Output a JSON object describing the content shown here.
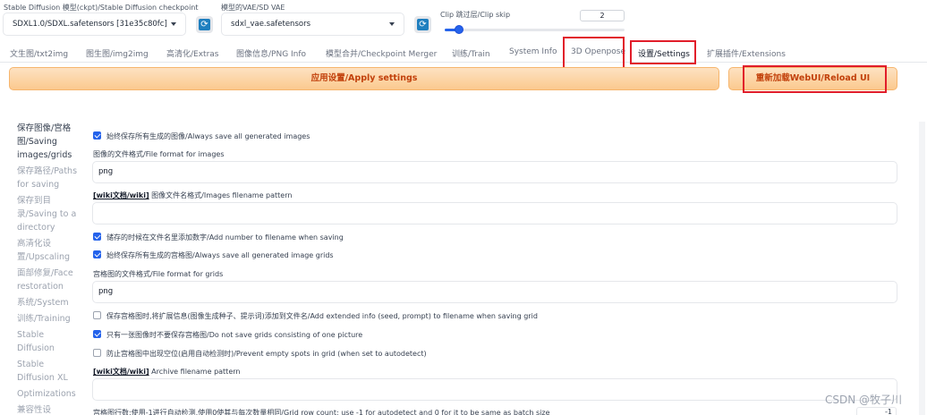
{
  "top": {
    "checkpoint_label": "Stable Diffusion 模型(ckpt)/Stable Diffusion checkpoint",
    "checkpoint_value": "SDXL1.0/SDXL.safetensors [31e35c80fc]",
    "vae_label": "模型的VAE/SD VAE",
    "vae_value": "sdxl_vae.safetensors",
    "clip_label": "Clip 跳过层/Clip skip",
    "clip_value": "2",
    "clip_fraction": 0.08,
    "refresh_glyph": "⟳"
  },
  "tabs": [
    {
      "label": "文生图/txt2img"
    },
    {
      "label": "图生图/img2img"
    },
    {
      "label": "高清化/Extras"
    },
    {
      "label": "图像信息/PNG Info"
    },
    {
      "label": "模型合并/Checkpoint Merger"
    },
    {
      "label": "训练/Train"
    },
    {
      "label": "System Info"
    },
    {
      "label": "3D Openpose"
    },
    {
      "label": "设置/Settings"
    },
    {
      "label": "扩展插件/Extensions"
    }
  ],
  "buttons": {
    "apply": "应用设置/Apply settings",
    "reload": "重新加载WebUI/Reload UI"
  },
  "nav": [
    "保存图像/宫格图/Saving images/grids",
    "保存路径/Paths for saving",
    "保存到目录/Saving to a directory",
    "高清化设置/Upscaling",
    "面部修复/Face restoration",
    "系统/System",
    "训练/Training",
    "Stable Diffusion",
    "Stable Diffusion XL",
    "Optimizations",
    "兼容性设"
  ],
  "settings": {
    "save_all": "始终保存所有生成的图像/Always save all generated images",
    "file_format_label": "图像的文件格式/File format for images",
    "file_format_value": "png",
    "wiki": "[wiki文档/wiki]",
    "filename_pattern_label": "图像文件名格式/Images filename pattern",
    "filename_pattern_value": "",
    "add_number": "储存的时候在文件名里添加数字/Add number to filename when saving",
    "save_grids": "始终保存所有生成的宫格图/Always save all generated image grids",
    "grid_format_label": "宫格图的文件格式/File format for grids",
    "grid_format_value": "png",
    "extended_info": "保存宫格图时,将扩展信息(图像生成种子、提示词)添加到文件名/Add extended info (seed, prompt) to filename when saving grid",
    "no_single_grid": "只有一张图像时不要保存宫格图/Do not save grids consisting of one picture",
    "prevent_empty": "防止宫格图中出现空位(启用自动检测时)/Prevent empty spots in grid (when set to autodetect)",
    "archive_label": "Archive filename pattern",
    "archive_value": "",
    "grid_rows_label": "宫格图行数;使用-1进行自动检测,使用0使其与每次数量相同/Grid row count; use -1 for autodetect and 0 for it to be same as batch size",
    "grid_rows_value": "-1"
  },
  "watermark": "CSDN @牧子川",
  "colors": {
    "accent": "#2563eb",
    "orange_text": "#c2410c",
    "highlight": "#e11d2a"
  }
}
